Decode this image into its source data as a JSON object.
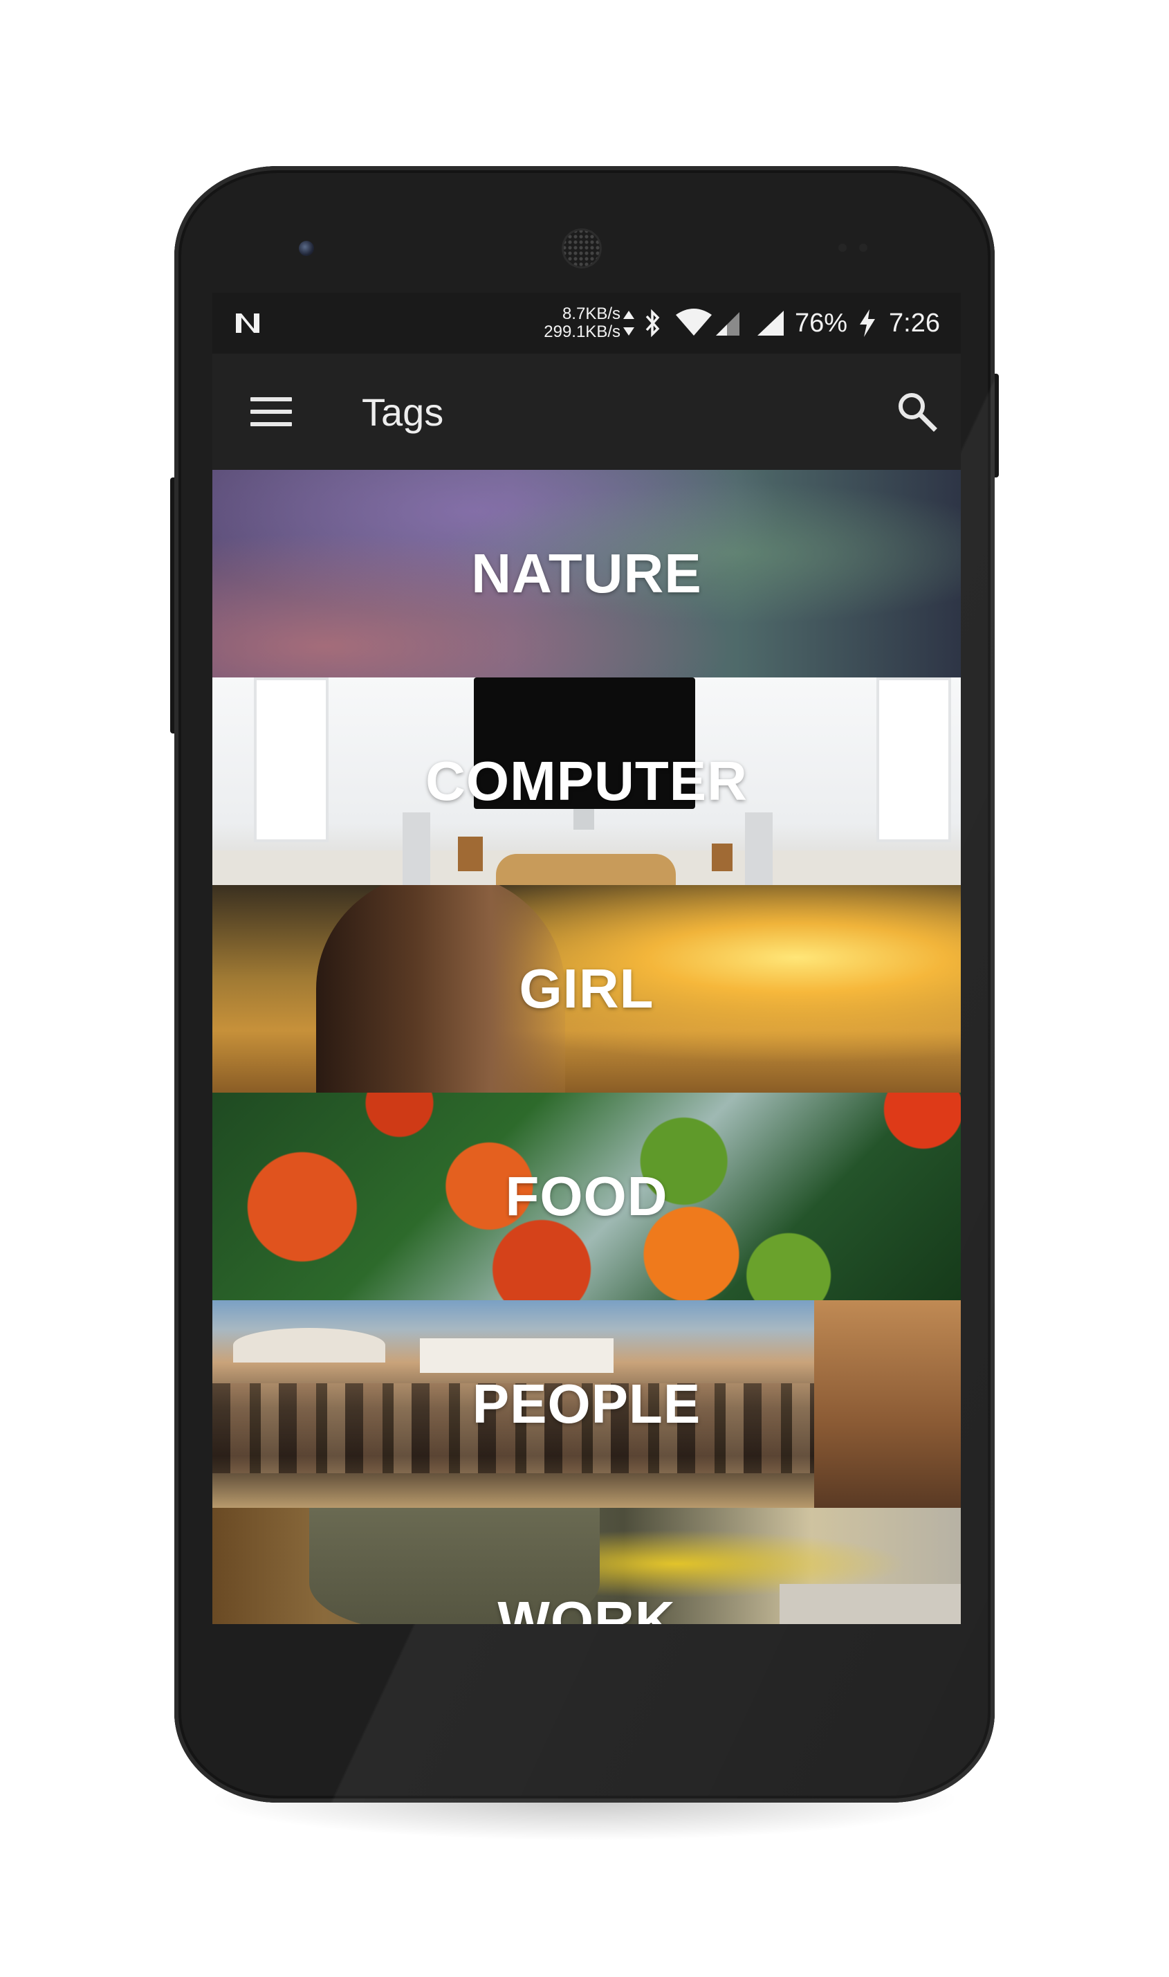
{
  "statusbar": {
    "download_speed": "8.7KB/s",
    "upload_speed": "299.1KB/s",
    "battery": "76%",
    "time": "7:26",
    "icons": [
      "n-notification-icon",
      "data-arrows-icon",
      "bluetooth-icon",
      "wifi-icon",
      "cell-signal-icon",
      "cell-signal-icon",
      "charging-bolt-icon"
    ]
  },
  "toolbar": {
    "title": "Tags",
    "menu_icon": "hamburger-menu-icon",
    "search_icon": "search-icon"
  },
  "tags": [
    {
      "label": "NATURE"
    },
    {
      "label": "COMPUTER"
    },
    {
      "label": "GIRL"
    },
    {
      "label": "FOOD"
    },
    {
      "label": "PEOPLE"
    },
    {
      "label": "WORK"
    }
  ],
  "colors": {
    "statusbar_bg": "#1a1a1a",
    "toolbar_bg": "#222222",
    "text": "#ffffff"
  }
}
